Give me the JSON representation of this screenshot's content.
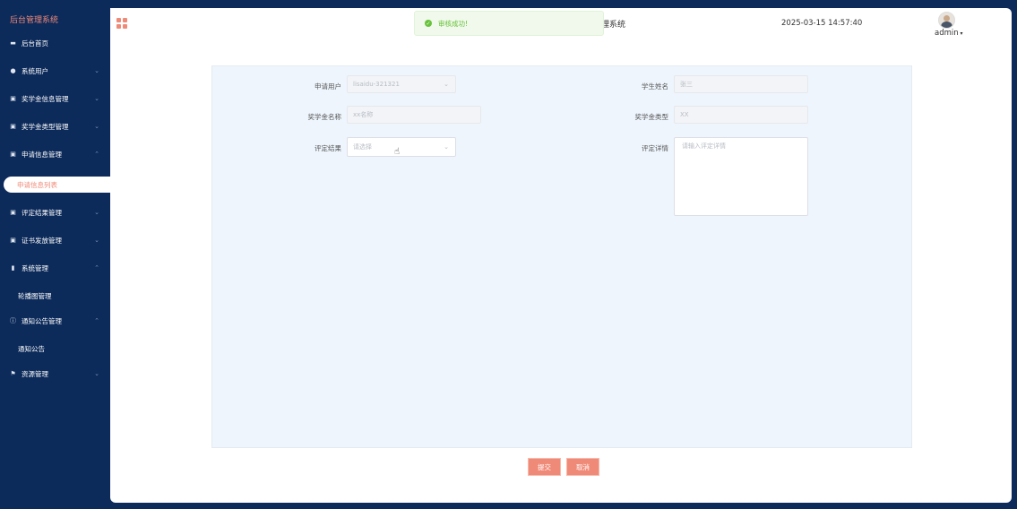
{
  "brand": "后台管理系统",
  "sidebar": {
    "items": [
      {
        "label": "后台首页",
        "icon": "monitor-icon"
      },
      {
        "label": "系统用户",
        "icon": "user-icon"
      },
      {
        "label": "奖学金信息管理",
        "icon": "chart-icon"
      },
      {
        "label": "奖学金类型管理",
        "icon": "chart-icon"
      },
      {
        "label": "申请信息管理",
        "icon": "chart-icon"
      },
      {
        "label": "评定结果管理",
        "icon": "chart-icon"
      },
      {
        "label": "证书发放管理",
        "icon": "chart-icon"
      },
      {
        "label": "系统管理",
        "icon": "bar-chart-icon"
      },
      {
        "label": "通知公告管理",
        "icon": "info-icon"
      },
      {
        "label": "资源管理",
        "icon": "flag-icon"
      }
    ],
    "sub": {
      "application_list": "申请信息列表",
      "carousel": "轮播图管理",
      "notice": "通知公告"
    }
  },
  "header": {
    "title_fragment": "理系统",
    "datetime": "2025-03-15 14:57:40",
    "user": "admin"
  },
  "toast": {
    "message": "审核成功!"
  },
  "form": {
    "applicant_label": "申请用户",
    "applicant_value": "lisaidu-321321",
    "student_label": "学生姓名",
    "student_value": "张三",
    "scholarship_name_label": "奖学金名称",
    "scholarship_name_value": "xx名称",
    "scholarship_type_label": "奖学金类型",
    "scholarship_type_value": "XX",
    "result_label": "评定结果",
    "result_placeholder": "请选择",
    "detail_label": "评定详情",
    "detail_placeholder": "请输入评定详情"
  },
  "buttons": {
    "submit": "提交",
    "cancel": "取消"
  },
  "colors": {
    "accent": "#f08a78",
    "sidebar": "#0c2a5a",
    "success": "#67c23a"
  }
}
